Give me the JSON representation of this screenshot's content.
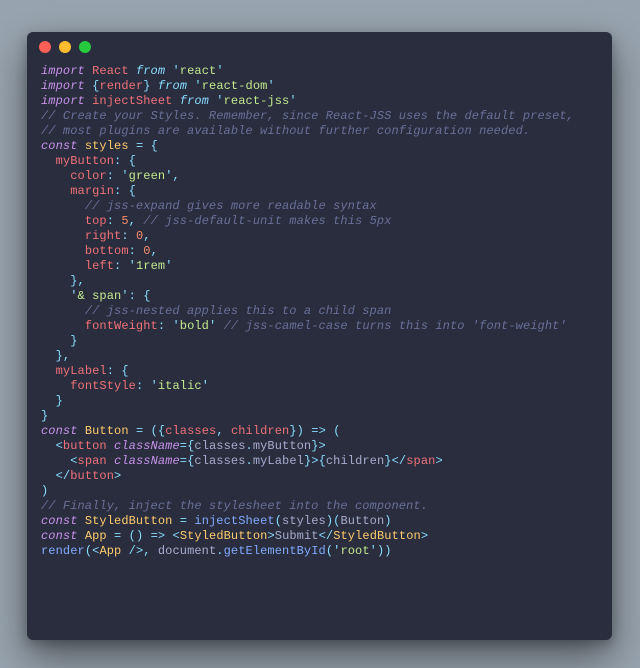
{
  "window": {
    "buttons": [
      {
        "name": "close",
        "color": "#ff5f56"
      },
      {
        "name": "minimize",
        "color": "#ffbd2e"
      },
      {
        "name": "zoom",
        "color": "#27c93f"
      }
    ]
  },
  "code": {
    "lines": [
      [
        [
          "kw",
          "import"
        ],
        [
          "plain",
          " "
        ],
        [
          "id",
          "React"
        ],
        [
          "plain",
          " "
        ],
        [
          "pkw",
          "from"
        ],
        [
          "plain",
          " "
        ],
        [
          "punc",
          "'"
        ],
        [
          "str",
          "react"
        ],
        [
          "punc",
          "'"
        ]
      ],
      [
        [
          "kw",
          "import"
        ],
        [
          "plain",
          " "
        ],
        [
          "punc",
          "{"
        ],
        [
          "id",
          "render"
        ],
        [
          "punc",
          "}"
        ],
        [
          "plain",
          " "
        ],
        [
          "pkw",
          "from"
        ],
        [
          "plain",
          " "
        ],
        [
          "punc",
          "'"
        ],
        [
          "str",
          "react-dom"
        ],
        [
          "punc",
          "'"
        ]
      ],
      [
        [
          "kw",
          "import"
        ],
        [
          "plain",
          " "
        ],
        [
          "id",
          "injectSheet"
        ],
        [
          "plain",
          " "
        ],
        [
          "pkw",
          "from"
        ],
        [
          "plain",
          " "
        ],
        [
          "punc",
          "'"
        ],
        [
          "str",
          "react-jss"
        ],
        [
          "punc",
          "'"
        ]
      ],
      [
        [
          "com",
          "// Create your Styles. Remember, since React-JSS uses the default preset,"
        ]
      ],
      [
        [
          "com",
          "// most plugins are available without further configuration needed."
        ]
      ],
      [
        [
          "kw",
          "const"
        ],
        [
          "plain",
          " "
        ],
        [
          "var",
          "styles"
        ],
        [
          "plain",
          " "
        ],
        [
          "punc",
          "="
        ],
        [
          "plain",
          " "
        ],
        [
          "punc",
          "{"
        ]
      ],
      [
        [
          "plain",
          "  "
        ],
        [
          "id",
          "myButton"
        ],
        [
          "punc",
          ":"
        ],
        [
          "plain",
          " "
        ],
        [
          "punc",
          "{"
        ]
      ],
      [
        [
          "plain",
          "    "
        ],
        [
          "id",
          "color"
        ],
        [
          "punc",
          ":"
        ],
        [
          "plain",
          " "
        ],
        [
          "punc",
          "'"
        ],
        [
          "str",
          "green"
        ],
        [
          "punc",
          "'"
        ],
        [
          "punc",
          ","
        ]
      ],
      [
        [
          "plain",
          "    "
        ],
        [
          "id",
          "margin"
        ],
        [
          "punc",
          ":"
        ],
        [
          "plain",
          " "
        ],
        [
          "punc",
          "{"
        ]
      ],
      [
        [
          "plain",
          "      "
        ],
        [
          "com",
          "// jss-expand gives more readable syntax"
        ]
      ],
      [
        [
          "plain",
          "      "
        ],
        [
          "id",
          "top"
        ],
        [
          "punc",
          ":"
        ],
        [
          "plain",
          " "
        ],
        [
          "num",
          "5"
        ],
        [
          "punc",
          ","
        ],
        [
          "plain",
          " "
        ],
        [
          "com",
          "// jss-default-unit makes this 5px"
        ]
      ],
      [
        [
          "plain",
          "      "
        ],
        [
          "id",
          "right"
        ],
        [
          "punc",
          ":"
        ],
        [
          "plain",
          " "
        ],
        [
          "num",
          "0"
        ],
        [
          "punc",
          ","
        ]
      ],
      [
        [
          "plain",
          "      "
        ],
        [
          "id",
          "bottom"
        ],
        [
          "punc",
          ":"
        ],
        [
          "plain",
          " "
        ],
        [
          "num",
          "0"
        ],
        [
          "punc",
          ","
        ]
      ],
      [
        [
          "plain",
          "      "
        ],
        [
          "id",
          "left"
        ],
        [
          "punc",
          ":"
        ],
        [
          "plain",
          " "
        ],
        [
          "punc",
          "'"
        ],
        [
          "str",
          "1rem"
        ],
        [
          "punc",
          "'"
        ]
      ],
      [
        [
          "plain",
          "    "
        ],
        [
          "punc",
          "},"
        ]
      ],
      [
        [
          "plain",
          "    "
        ],
        [
          "punc",
          "'"
        ],
        [
          "str",
          "& span"
        ],
        [
          "punc",
          "'"
        ],
        [
          "punc",
          ":"
        ],
        [
          "plain",
          " "
        ],
        [
          "punc",
          "{"
        ]
      ],
      [
        [
          "plain",
          "      "
        ],
        [
          "com",
          "// jss-nested applies this to a child span"
        ]
      ],
      [
        [
          "plain",
          "      "
        ],
        [
          "id",
          "fontWeight"
        ],
        [
          "punc",
          ":"
        ],
        [
          "plain",
          " "
        ],
        [
          "punc",
          "'"
        ],
        [
          "str",
          "bold"
        ],
        [
          "punc",
          "'"
        ],
        [
          "plain",
          " "
        ],
        [
          "com",
          "// jss-camel-case turns this into 'font-weight'"
        ]
      ],
      [
        [
          "plain",
          "    "
        ],
        [
          "punc",
          "}"
        ]
      ],
      [
        [
          "plain",
          "  "
        ],
        [
          "punc",
          "},"
        ]
      ],
      [
        [
          "plain",
          "  "
        ],
        [
          "id",
          "myLabel"
        ],
        [
          "punc",
          ":"
        ],
        [
          "plain",
          " "
        ],
        [
          "punc",
          "{"
        ]
      ],
      [
        [
          "plain",
          "    "
        ],
        [
          "id",
          "fontStyle"
        ],
        [
          "punc",
          ":"
        ],
        [
          "plain",
          " "
        ],
        [
          "punc",
          "'"
        ],
        [
          "str",
          "italic"
        ],
        [
          "punc",
          "'"
        ]
      ],
      [
        [
          "plain",
          "  "
        ],
        [
          "punc",
          "}"
        ]
      ],
      [
        [
          "punc",
          "}"
        ]
      ],
      [
        [
          "kw",
          "const"
        ],
        [
          "plain",
          " "
        ],
        [
          "var",
          "Button"
        ],
        [
          "plain",
          " "
        ],
        [
          "punc",
          "="
        ],
        [
          "plain",
          " "
        ],
        [
          "punc",
          "("
        ],
        [
          "punc",
          "{"
        ],
        [
          "id",
          "classes"
        ],
        [
          "punc",
          ","
        ],
        [
          "plain",
          " "
        ],
        [
          "id",
          "children"
        ],
        [
          "punc",
          "}"
        ],
        [
          "punc",
          ")"
        ],
        [
          "plain",
          " "
        ],
        [
          "punc",
          "=>"
        ],
        [
          "plain",
          " "
        ],
        [
          "punc",
          "("
        ]
      ],
      [
        [
          "plain",
          "  "
        ],
        [
          "punc",
          "<"
        ],
        [
          "id",
          "button"
        ],
        [
          "plain",
          " "
        ],
        [
          "attr",
          "className"
        ],
        [
          "punc",
          "="
        ],
        [
          "punc",
          "{"
        ],
        [
          "plain",
          "classes"
        ],
        [
          "punc",
          "."
        ],
        [
          "plain",
          "myButton"
        ],
        [
          "punc",
          "}"
        ],
        [
          "punc",
          ">"
        ]
      ],
      [
        [
          "plain",
          "    "
        ],
        [
          "punc",
          "<"
        ],
        [
          "id",
          "span"
        ],
        [
          "plain",
          " "
        ],
        [
          "attr",
          "className"
        ],
        [
          "punc",
          "="
        ],
        [
          "punc",
          "{"
        ],
        [
          "plain",
          "classes"
        ],
        [
          "punc",
          "."
        ],
        [
          "plain",
          "myLabel"
        ],
        [
          "punc",
          "}"
        ],
        [
          "punc",
          ">"
        ],
        [
          "punc",
          "{"
        ],
        [
          "plain",
          "children"
        ],
        [
          "punc",
          "}"
        ],
        [
          "punc",
          "</"
        ],
        [
          "id",
          "span"
        ],
        [
          "punc",
          ">"
        ]
      ],
      [
        [
          "plain",
          "  "
        ],
        [
          "punc",
          "</"
        ],
        [
          "id",
          "button"
        ],
        [
          "punc",
          ">"
        ]
      ],
      [
        [
          "punc",
          ")"
        ]
      ],
      [
        [
          "com",
          "// Finally, inject the stylesheet into the component."
        ]
      ],
      [
        [
          "kw",
          "const"
        ],
        [
          "plain",
          " "
        ],
        [
          "var",
          "StyledButton"
        ],
        [
          "plain",
          " "
        ],
        [
          "punc",
          "="
        ],
        [
          "plain",
          " "
        ],
        [
          "fn",
          "injectSheet"
        ],
        [
          "punc",
          "("
        ],
        [
          "plain",
          "styles"
        ],
        [
          "punc",
          ")("
        ],
        [
          "plain",
          "Button"
        ],
        [
          "punc",
          ")"
        ]
      ],
      [
        [
          "kw",
          "const"
        ],
        [
          "plain",
          " "
        ],
        [
          "var",
          "App"
        ],
        [
          "plain",
          " "
        ],
        [
          "punc",
          "="
        ],
        [
          "plain",
          " "
        ],
        [
          "punc",
          "()"
        ],
        [
          "plain",
          " "
        ],
        [
          "punc",
          "=>"
        ],
        [
          "plain",
          " "
        ],
        [
          "punc",
          "<"
        ],
        [
          "var",
          "StyledButton"
        ],
        [
          "punc",
          ">"
        ],
        [
          "plain",
          "Submit"
        ],
        [
          "punc",
          "</"
        ],
        [
          "var",
          "StyledButton"
        ],
        [
          "punc",
          ">"
        ]
      ],
      [
        [
          "fn",
          "render"
        ],
        [
          "punc",
          "("
        ],
        [
          "punc",
          "<"
        ],
        [
          "var",
          "App"
        ],
        [
          "plain",
          " "
        ],
        [
          "punc",
          "/>"
        ],
        [
          "punc",
          ","
        ],
        [
          "plain",
          " document"
        ],
        [
          "punc",
          "."
        ],
        [
          "fn",
          "getElementById"
        ],
        [
          "punc",
          "("
        ],
        [
          "punc",
          "'"
        ],
        [
          "str",
          "root"
        ],
        [
          "punc",
          "'"
        ],
        [
          "punc",
          "))"
        ]
      ]
    ]
  }
}
